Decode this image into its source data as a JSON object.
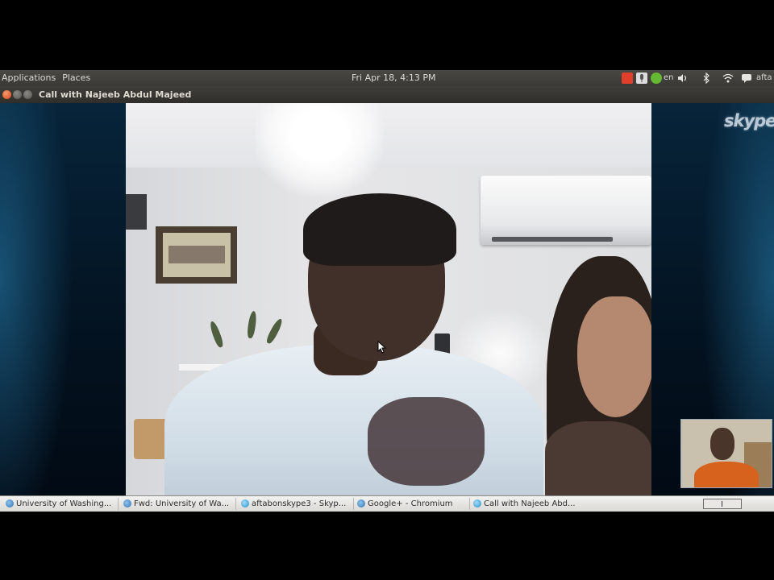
{
  "top_panel": {
    "menu": [
      "Applications",
      "Places"
    ],
    "clock": "Fri Apr 18, 4:13 PM",
    "indicator_text": "en",
    "user_text": "afta",
    "icons": [
      "stop-icon",
      "microphone-icon",
      "skype-status-icon",
      "keyboard-icon",
      "volume-icon",
      "bluetooth-icon",
      "wifi-icon",
      "chat-icon"
    ]
  },
  "window": {
    "title": "Call with Najeeb Abdul Majeed",
    "buttons": [
      "close",
      "minimize",
      "maximize"
    ]
  },
  "skype": {
    "logo_text": "skype"
  },
  "taskbar": {
    "items": [
      {
        "label": "University of Washing...",
        "icon": "chromium"
      },
      {
        "label": "Fwd: University of Wa...",
        "icon": "chromium"
      },
      {
        "label": "aftabonskype3 - Skyp...",
        "icon": "skype"
      },
      {
        "label": "Google+ - Chromium",
        "icon": "chromium"
      },
      {
        "label": "Call with Najeeb Abd...",
        "icon": "skype"
      }
    ],
    "workspace_indicator": "|"
  },
  "colors": {
    "panel": "#3f3e3a",
    "close_button": "#e25d2b",
    "skype_blue": "#0a3b5c"
  }
}
